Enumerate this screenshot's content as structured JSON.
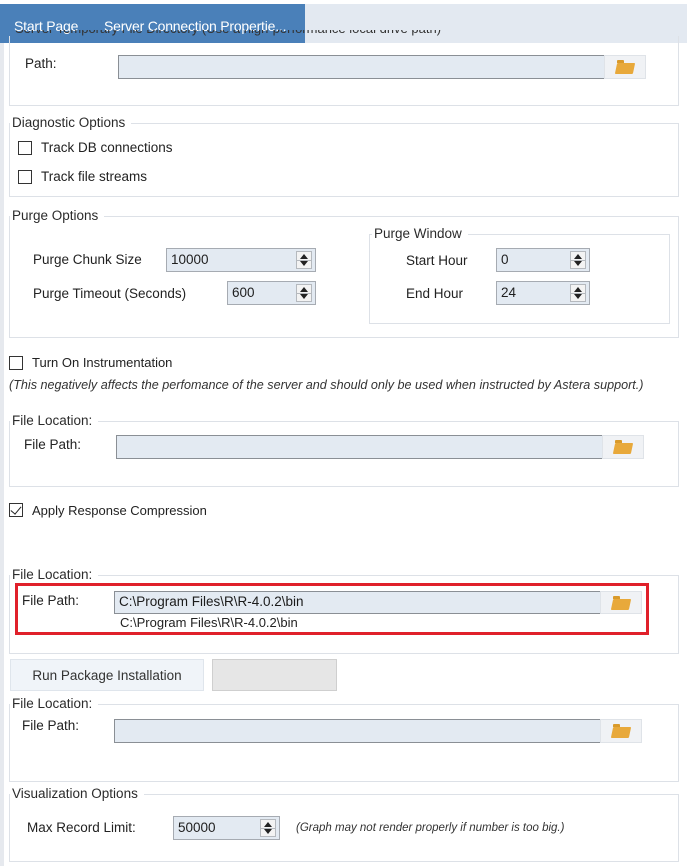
{
  "tabs": [
    {
      "label": "Start Page",
      "active": false
    },
    {
      "label": "Server Connection Propertie...",
      "active": true
    }
  ],
  "colors": {
    "tab_active_bg": "#4a80b9",
    "tabstrip_bg": "#e3e9f1",
    "input_bg": "#e3eaf2",
    "highlight_border": "#e0202a",
    "folder_icon": "#e8a93b"
  },
  "temp_directory": {
    "title": "Server Temporary File Directory (Use a high-performance local drive path)",
    "path_label": "Path:",
    "path_value": "",
    "browse_icon": "folder-icon"
  },
  "diagnostic": {
    "title": "Diagnostic Options",
    "options": [
      {
        "label": "Track DB connections",
        "checked": false
      },
      {
        "label": "Track file streams",
        "checked": false
      }
    ]
  },
  "purge": {
    "title": "Purge Options",
    "chunk_size_label": "Purge Chunk Size",
    "chunk_size_value": "10000",
    "timeout_label": "Purge Timeout (Seconds)",
    "timeout_value": "600",
    "window": {
      "title": "Purge Window",
      "start_label": "Start Hour",
      "start_value": "0",
      "end_label": "End Hour",
      "end_value": "24"
    }
  },
  "instrumentation": {
    "label": "Turn On Instrumentation",
    "checked": false,
    "note": "(This negatively affects the perfomance of the server and should only be used when instructed by Astera support.)",
    "file_location_title": "File Location:",
    "file_path_label": "File Path:",
    "file_path_value": ""
  },
  "compression": {
    "label": "Apply Response Compression",
    "checked": true
  },
  "r_location": {
    "title": "File Location:",
    "file_path_label": "File Path:",
    "file_path_value": "C:\\Program Files\\R\\R-4.0.2\\bin",
    "file_path_display": "C:\\Program Files\\R\\R-4.0.2\\bin"
  },
  "package": {
    "run_label": "Run Package Installation",
    "secondary_label": ""
  },
  "third_location": {
    "title": "File Location:",
    "file_path_label": "File Path:",
    "file_path_value": ""
  },
  "visualization": {
    "title": "Visualization Options",
    "max_record_label": "Max Record Limit:",
    "max_record_value": "50000",
    "note": "(Graph may not render properly if number is too big.)"
  }
}
